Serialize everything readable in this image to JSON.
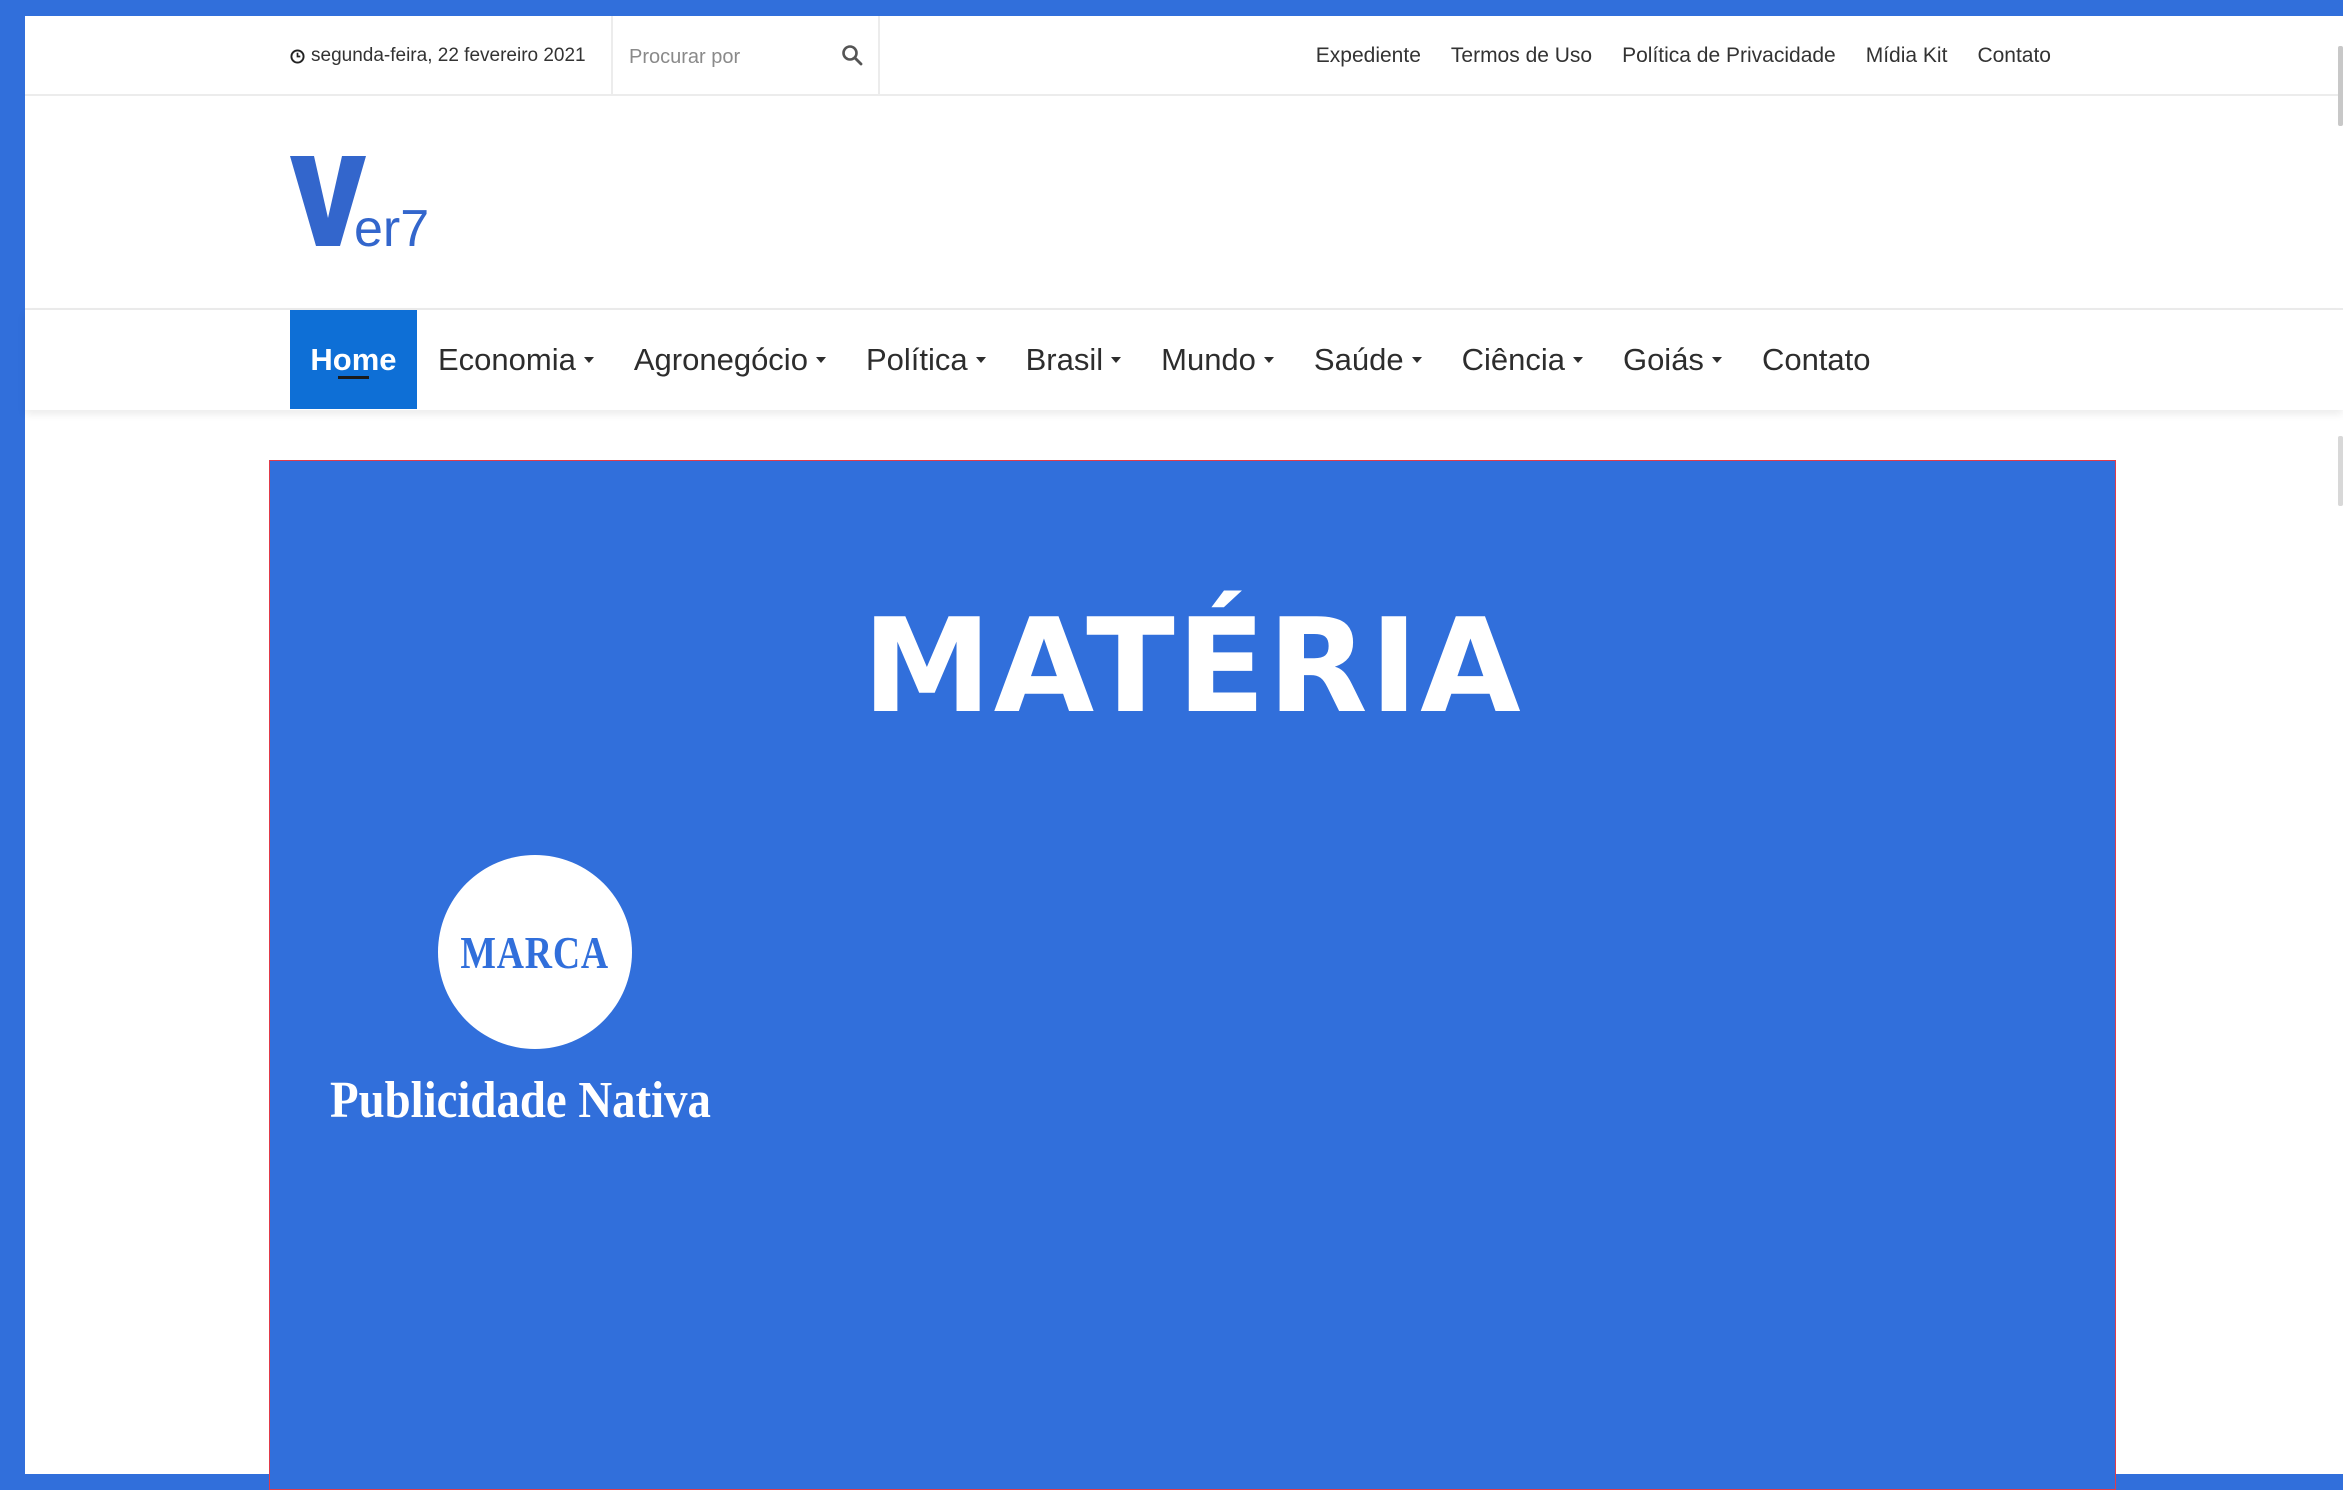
{
  "topbar": {
    "date": "segunda-feira, 22 fevereiro 2021",
    "search_placeholder": "Procurar por",
    "links": [
      "Expediente",
      "Termos de Uso",
      "Política de Privacidade",
      "Mídia Kit",
      "Contato"
    ]
  },
  "logo": {
    "letter": "V",
    "rest": "er7"
  },
  "nav": {
    "home": "Home",
    "items": [
      {
        "label": "Economia",
        "dropdown": true
      },
      {
        "label": "Agronegócio",
        "dropdown": true
      },
      {
        "label": "Política",
        "dropdown": true
      },
      {
        "label": "Brasil",
        "dropdown": true
      },
      {
        "label": "Mundo",
        "dropdown": true
      },
      {
        "label": "Saúde",
        "dropdown": true
      },
      {
        "label": "Ciência",
        "dropdown": true
      },
      {
        "label": "Goiás",
        "dropdown": true
      },
      {
        "label": "Contato",
        "dropdown": false
      }
    ]
  },
  "banner": {
    "title": "MATÉRIA",
    "marca": "MARCA",
    "subtitle": "Publicidade Nativa"
  },
  "colors": {
    "background": "#316fdb",
    "nav_active": "#0e6fd6",
    "logo": "#3366cc"
  },
  "icons": {
    "clock": "clock-icon",
    "search": "search-icon",
    "caret": "chevron-down-icon"
  }
}
